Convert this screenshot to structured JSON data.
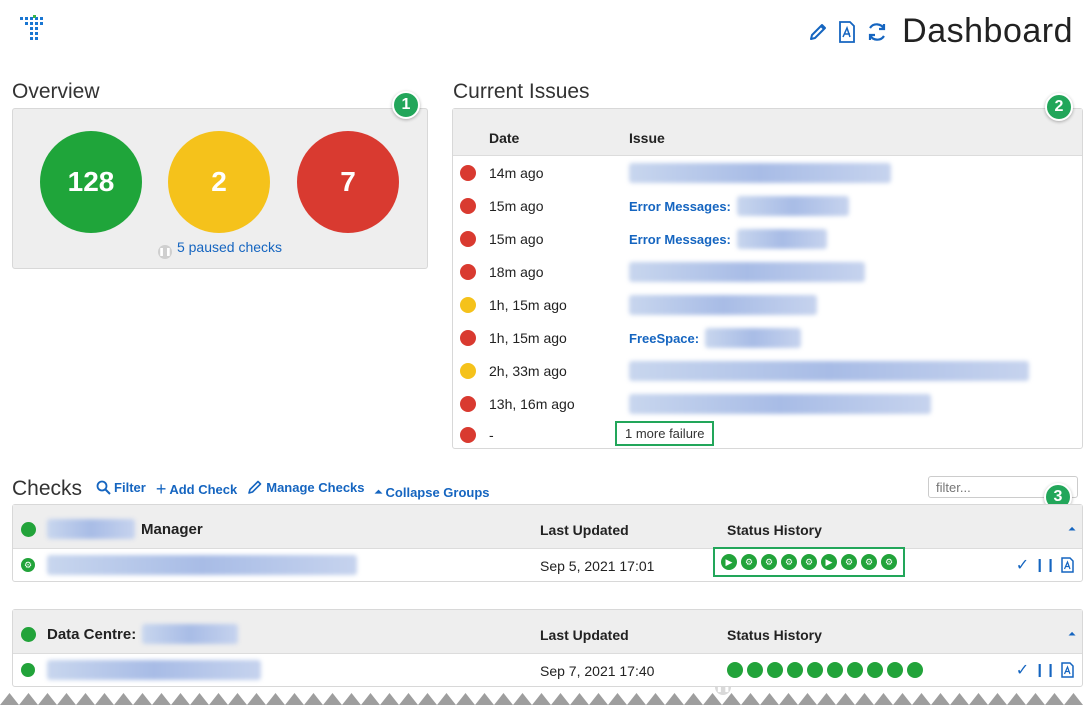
{
  "header": {
    "title": "Dashboard",
    "actions": [
      "edit-icon",
      "pdf-icon",
      "refresh-icon"
    ]
  },
  "overview": {
    "title": "Overview",
    "badge": "1",
    "counts": [
      {
        "value": "128",
        "color": "#1fa53a"
      },
      {
        "value": "2",
        "color": "#f5c21b"
      },
      {
        "value": "7",
        "color": "#d93a30"
      }
    ],
    "paused_text": "5 paused checks"
  },
  "issues": {
    "title": "Current Issues",
    "badge": "2",
    "col_date": "Date",
    "col_issue": "Issue",
    "rows": [
      {
        "date": "14m ago",
        "status": "#d93a30",
        "label": ""
      },
      {
        "date": "15m ago",
        "status": "#d93a30",
        "label": "Error Messages:"
      },
      {
        "date": "15m ago",
        "status": "#d93a30",
        "label": "Error Messages:"
      },
      {
        "date": "18m ago",
        "status": "#d93a30",
        "label": ""
      },
      {
        "date": "1h, 15m ago",
        "status": "#f5c21b",
        "label": ""
      },
      {
        "date": "1h, 15m ago",
        "status": "#d93a30",
        "label": "FreeSpace:"
      },
      {
        "date": "2h, 33m ago",
        "status": "#f5c21b",
        "label": ""
      },
      {
        "date": "13h, 16m ago",
        "status": "#d93a30",
        "label": ""
      },
      {
        "date": "-",
        "status": "#d93a30",
        "label": ""
      }
    ],
    "more": "1 more failure"
  },
  "checks": {
    "title": "Checks",
    "badge": "3",
    "tools": {
      "filter": "Filter",
      "add": "Add Check",
      "manage": "Manage Checks",
      "collapse": "Collapse Groups"
    },
    "filter_placeholder": "filter...",
    "groups": [
      {
        "name": "Manager",
        "col_updated": "Last Updated",
        "col_history": "Status History",
        "row_updated": "Sep 5, 2021 17:01"
      },
      {
        "name": "Data Centre:",
        "col_updated": "Last Updated",
        "col_history": "Status History",
        "row_updated": "Sep 7, 2021 17:40"
      }
    ]
  }
}
